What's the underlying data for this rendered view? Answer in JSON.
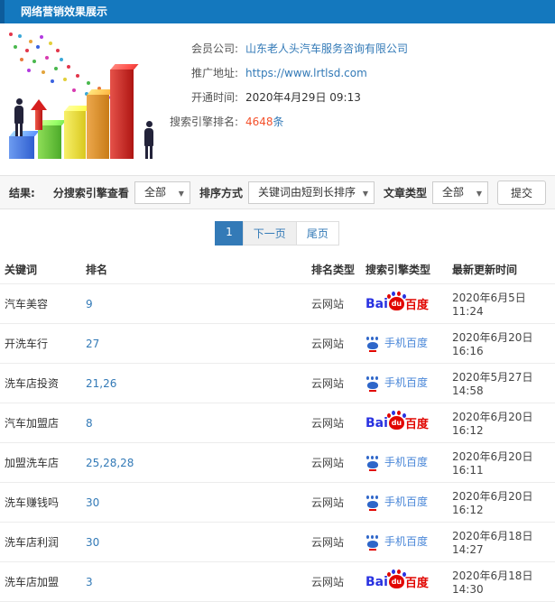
{
  "header": {
    "title": "网络营销效果展示"
  },
  "info": {
    "company_label": "会员公司:",
    "company_value": "山东老人头汽车服务咨询有限公司",
    "url_label": "推广地址:",
    "url_value": "https://www.lrtlsd.com",
    "opened_label": "开通时间:",
    "opened_value": "2020年4月29日 09:13",
    "ranking_label": "搜索引擎排名:",
    "ranking_count": "4648",
    "ranking_unit": "条"
  },
  "filter": {
    "result_label": "结果:",
    "engine_label": "分搜索引擎查看",
    "engine_value": "全部",
    "sort_label": "排序方式",
    "sort_value": "关键词由短到长排序",
    "article_label": "文章类型",
    "article_value": "全部",
    "submit_label": "提交",
    "caret": "▼"
  },
  "pagination": {
    "current": "1",
    "next": "下一页",
    "last": "尾页"
  },
  "table": {
    "headers": [
      "关键词",
      "排名",
      "排名类型",
      "搜索引擎类型",
      "最新更新时间"
    ],
    "engine_baidu": {
      "bai": "Bai",
      "du": "du",
      "cn": "百度"
    },
    "engine_mobile": {
      "text": "手机百度"
    },
    "rows": [
      {
        "keyword": "汽车美容",
        "rank": "9",
        "rank_type": "云网站",
        "engine": "baidu",
        "updated": "2020年6月5日 11:24"
      },
      {
        "keyword": "开洗车行",
        "rank": "27",
        "rank_type": "云网站",
        "engine": "mobile",
        "updated": "2020年6月20日 16:16"
      },
      {
        "keyword": "洗车店投资",
        "rank": "21,26",
        "rank_type": "云网站",
        "engine": "mobile",
        "updated": "2020年5月27日 14:58"
      },
      {
        "keyword": "汽车加盟店",
        "rank": "8",
        "rank_type": "云网站",
        "engine": "baidu",
        "updated": "2020年6月20日 16:12"
      },
      {
        "keyword": "加盟洗车店",
        "rank": "25,28,28",
        "rank_type": "云网站",
        "engine": "mobile",
        "updated": "2020年6月20日 16:11"
      },
      {
        "keyword": "洗车赚钱吗",
        "rank": "30",
        "rank_type": "云网站",
        "engine": "mobile",
        "updated": "2020年6月20日 16:12"
      },
      {
        "keyword": "洗车店利润",
        "rank": "30",
        "rank_type": "云网站",
        "engine": "mobile",
        "updated": "2020年6月18日 14:27"
      },
      {
        "keyword": "洗车店加盟",
        "rank": "3",
        "rank_type": "云网站",
        "engine": "baidu",
        "updated": "2020年6月18日 14:30"
      }
    ]
  },
  "colors": {
    "header_bg": "#1478be",
    "link_blue": "#337ab7",
    "accent_orange": "#f4512c",
    "baidu_red": "#e10601",
    "baidu_blue": "#2932e1",
    "mobile_baidu_blue": "#4a87d8",
    "pagination_active": "#337ab7"
  }
}
